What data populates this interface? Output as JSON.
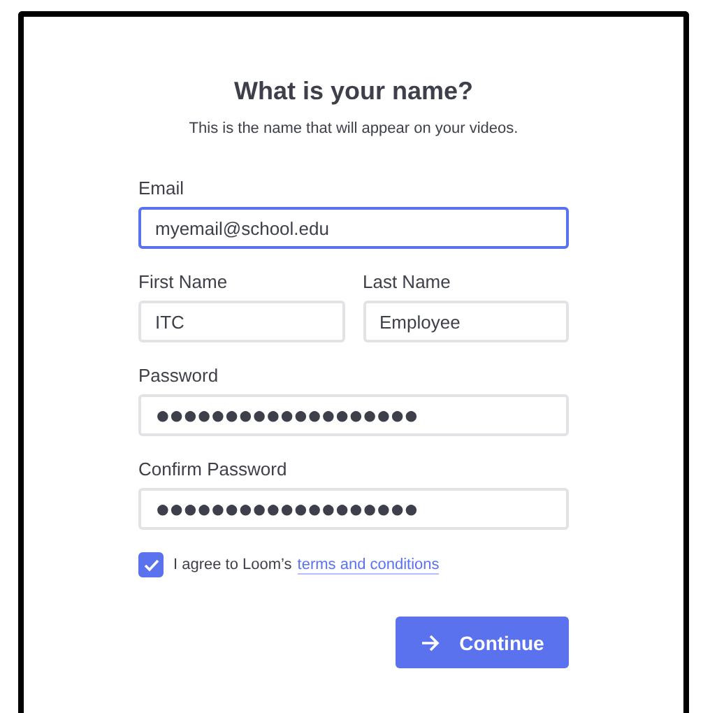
{
  "title": "What is your name?",
  "subtitle": "This is the name that will appear on your videos.",
  "fields": [
    {
      "label": "Email",
      "value": "myemail@school.edu",
      "focused": true,
      "half": false
    },
    {
      "label": "First Name",
      "value": "ITC",
      "focused": false,
      "half": true
    },
    {
      "label": "Last Name",
      "value": "Employee",
      "focused": false,
      "half": true
    },
    {
      "label": "Password",
      "value": "●●●●●●●●●●●●●●●●●●●",
      "focused": false,
      "half": false
    },
    {
      "label": "Confirm Password",
      "value": "●●●●●●●●●●●●●●●●●●●",
      "focused": false,
      "half": false
    }
  ],
  "agreement": {
    "checked": true,
    "text": "I agree to Loom’s",
    "link": "terms and conditions"
  },
  "continue_button": {
    "label": "Continue"
  }
}
